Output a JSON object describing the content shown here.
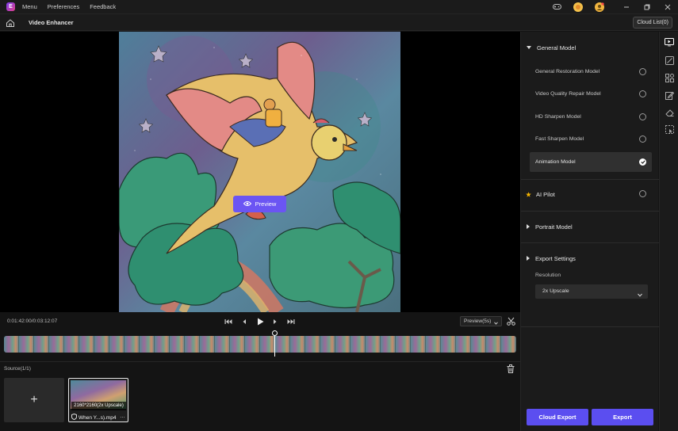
{
  "titlebar": {
    "menu": [
      "Menu",
      "Preferences",
      "Feedback"
    ],
    "logo_letter": "E"
  },
  "subbar": {
    "page_title": "Video Enhancer",
    "cloud_list": "Cloud List(0)"
  },
  "preview": {
    "button_label": "Preview"
  },
  "controls": {
    "timecode": "0:01:42:00/0:03:12:07",
    "preview_duration": "Preview(5s)"
  },
  "source": {
    "label": "Source(1/1)",
    "add_symbol": "+",
    "file_badge": "2160*2160(2x Upscale)",
    "file_name": "When Y...s).mp4",
    "more": "…"
  },
  "panel": {
    "general_model": {
      "title": "General Model",
      "models": [
        {
          "label": "General Restoration Model",
          "selected": false
        },
        {
          "label": "Video Quality Repair Model",
          "selected": false
        },
        {
          "label": "HD Sharpen Model",
          "selected": false
        },
        {
          "label": "Fast Sharpen Model",
          "selected": false
        },
        {
          "label": "Animation Model",
          "selected": true
        }
      ]
    },
    "ai_pilot": "AI Pilot",
    "portrait_model": "Portrait Model",
    "export_settings": "Export Settings",
    "resolution_label": "Resolution",
    "resolution_value": "2x Upscale",
    "cloud_export": "Cloud Export",
    "export": "Export"
  },
  "colors": {
    "accent": "#5b4ef0",
    "preview_button": "#6b55f3",
    "ai_pilot_star": "#f5b400"
  }
}
